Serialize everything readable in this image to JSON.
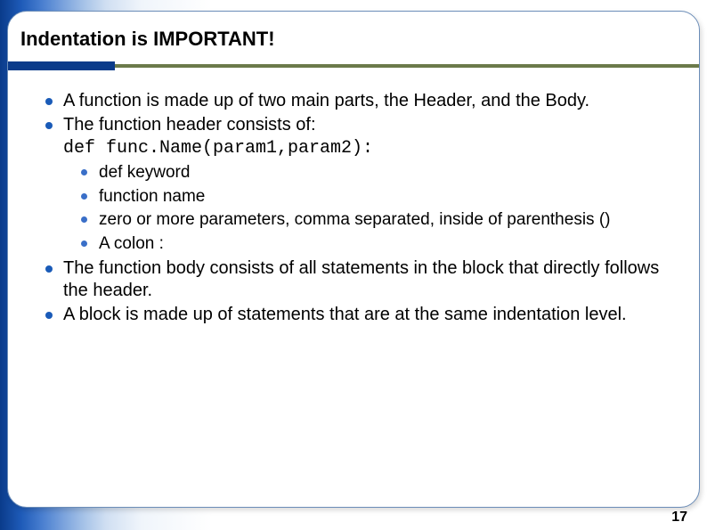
{
  "title": "Indentation is IMPORTANT!",
  "bullets": {
    "b1": "A function is made up of two main parts, the Header, and the Body.",
    "b2": "The function header consists of:",
    "code": "def func.Name(param1,param2):",
    "sub1": "def keyword",
    "sub2": "function name",
    "sub3": "zero or more parameters, comma separated, inside of parenthesis ()",
    "sub4": "A colon :",
    "b3": "The function body consists of all statements in the block that directly follows the header.",
    "b4": "A block is made up of statements that are at the same indentation level."
  },
  "pageNumber": "17"
}
